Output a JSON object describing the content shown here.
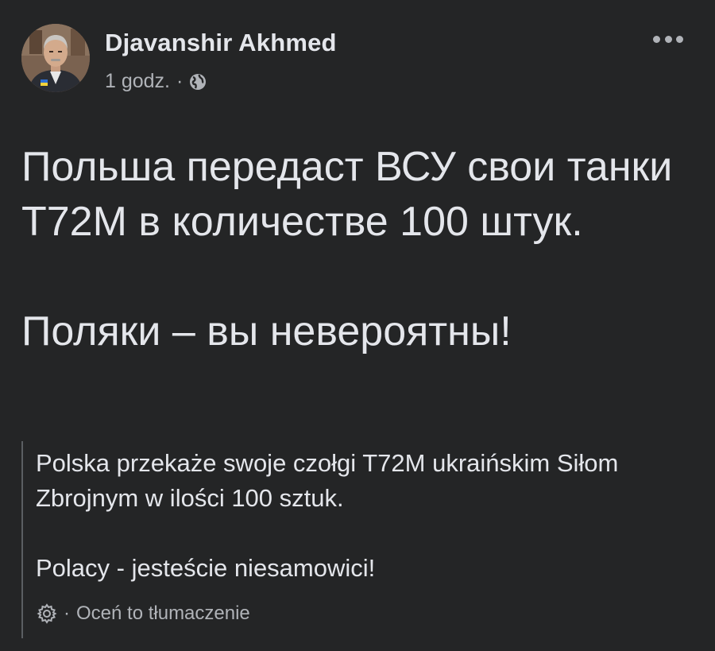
{
  "post": {
    "author": "Djavanshir Akhmed",
    "time": "1 godz.",
    "separator": "·",
    "privacy_icon": "globe-icon",
    "more_icon": "more-options-icon",
    "text": {
      "paragraph1": "Польша передаст ВСУ свои танки Т72М в количестве 100 штук.",
      "paragraph2": "Поляки – вы невероятны!"
    },
    "translation": {
      "paragraph1": "Polska przekaże swoje czołgi T72M ukraińskim Siłom Zbrojnym w ilości 100 sztuk.",
      "paragraph2": "Polacy - jesteście niesamowici!",
      "settings_icon": "gear-icon",
      "separator": "·",
      "rate_label": "Oceń to tłumaczenie"
    }
  },
  "colors": {
    "background": "#242526",
    "primary_text": "#e4e6eb",
    "secondary_text": "#b0b3b8",
    "quote_border": "#5b5e62"
  }
}
